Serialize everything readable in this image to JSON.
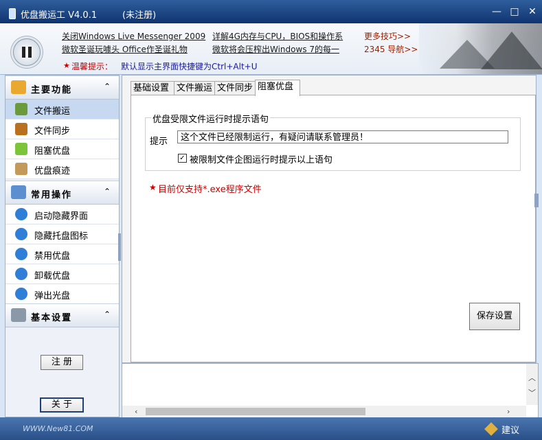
{
  "window": {
    "title": "优盘搬运工 V4.0.1",
    "registration_status": "(未注册)",
    "controls": {
      "minimize": "—",
      "maximize": "□",
      "close": "✕"
    }
  },
  "header": {
    "links": [
      "关闭Windows Live Messenger 2009",
      "微软圣诞玩噱头 Office作圣诞礼物",
      "详解4G内存与CPU，BIOS和操作系",
      "微软将会压榨出Windows 7的每一"
    ],
    "more_tips": "更多技巧>>",
    "nav_2345": "2345 导航>>",
    "tip_label": "温馨提示：",
    "tip_text": "默认显示主界面快捷键为Ctrl+Alt+U"
  },
  "sidebar": {
    "sections": [
      {
        "label": "主要功能",
        "items": [
          "文件搬运",
          "文件同步",
          "阻塞优盘",
          "优盘痕迹"
        ]
      },
      {
        "label": "常用操作",
        "items": [
          "启动隐藏界面",
          "隐藏托盘图标",
          "禁用优盘",
          "卸载优盘",
          "弹出光盘"
        ]
      },
      {
        "label": "基本设置",
        "items": []
      }
    ],
    "register_label": "注 册",
    "about_label": "关 于"
  },
  "tabs": [
    "基础设置",
    "文件搬运",
    "文件同步",
    "阻塞优盘"
  ],
  "selected_tab": "阻塞优盘",
  "content": {
    "group_title": "优盘受限文件运行时提示语句",
    "prompt_label": "提示",
    "prompt_value": "这个文件已经限制运行，有疑问请联系管理员！",
    "checkbox_label": "被限制文件企图运行时提示以上语句",
    "checkbox_checked": true,
    "note": "目前仅支持*.exe程序文件",
    "save_label": "保存设置"
  },
  "statusbar": {
    "site": "WWW.New81.COM",
    "suggest": "建议"
  },
  "colors": {
    "titlebar": "#0f3470",
    "accent_red": "#cc0000",
    "tip_blue": "#1a1aa0",
    "active_item": "#c6d9f1"
  }
}
